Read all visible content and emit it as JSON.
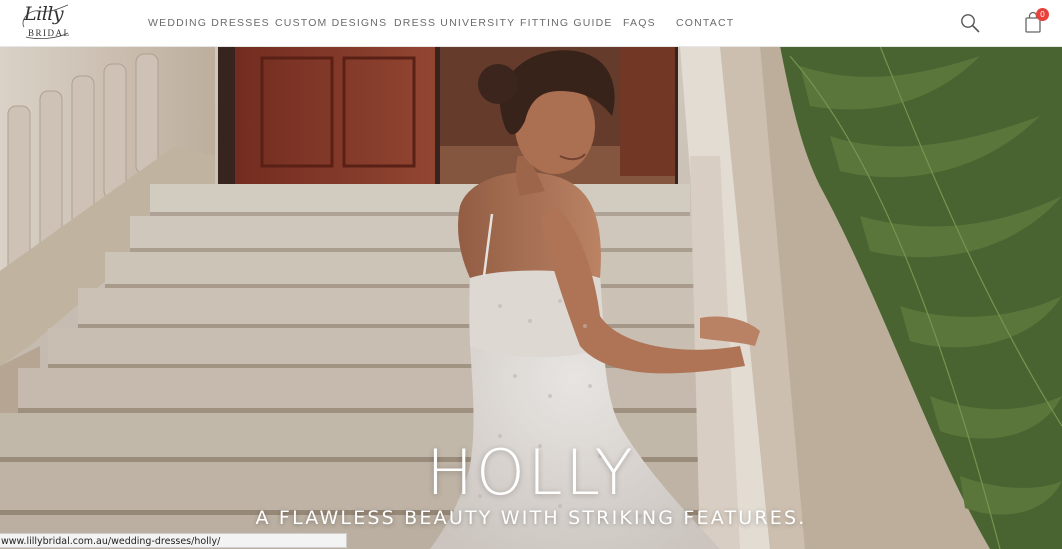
{
  "brand": {
    "logo_script": "Lilly",
    "logo_sub": "BRIDAL"
  },
  "nav": {
    "items": [
      {
        "label": "WEDDING DRESSES"
      },
      {
        "label": "CUSTOM DESIGNS"
      },
      {
        "label": "DRESS UNIVERSITY"
      },
      {
        "label": "FITTING GUIDE"
      },
      {
        "label": "FAQS"
      },
      {
        "label": "CONTACT"
      }
    ]
  },
  "header_icons": {
    "search": "search-icon",
    "cart": "shopping-bag-icon",
    "cart_count": "0",
    "badge_color": "#e8413c"
  },
  "hero": {
    "title": "HOLLY",
    "subtitle": "A FLAWLESS BEAUTY WITH STRIKING FEATURES."
  },
  "status_bar": {
    "url": "www.lillybridal.com.au/wedding-dresses/holly/"
  }
}
